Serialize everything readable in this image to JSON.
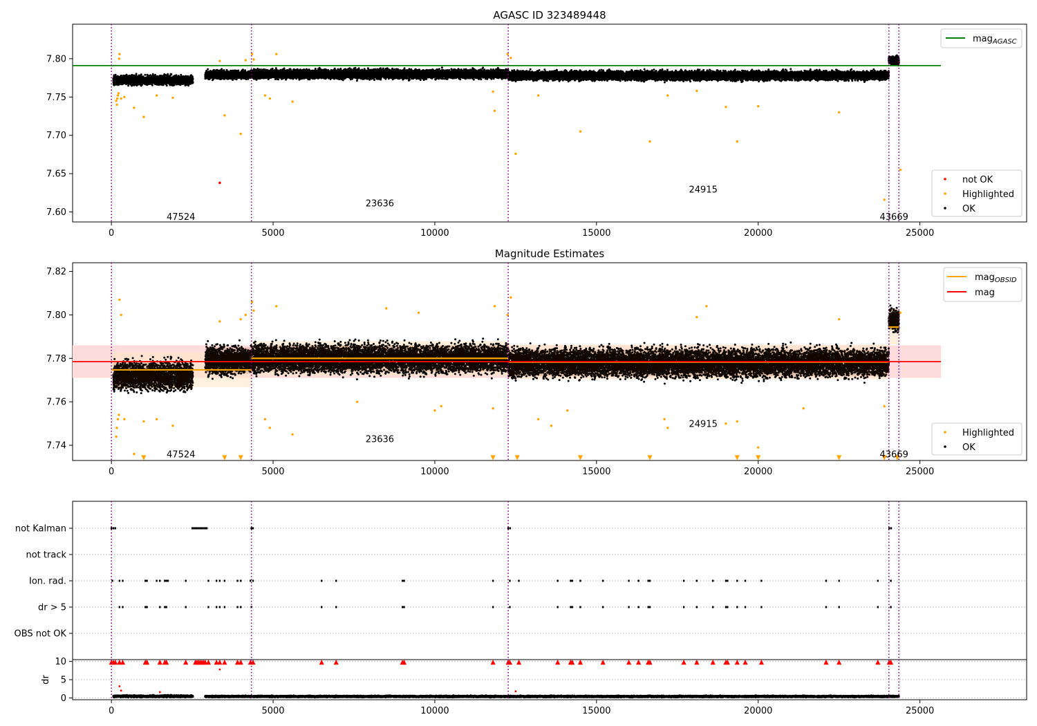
{
  "figure": {
    "panel1_title": "AGASC ID 323489448",
    "panel2_title": "Magnitude Estimates"
  },
  "colors": {
    "ok": "#000000",
    "not_ok": "#ff0000",
    "highlighted": "#ffa500",
    "mag_agasc": "#008000",
    "mag_obsid": "#ffa500",
    "mag": "#ff0000",
    "obs_boundary": "#800080",
    "mag_band": "#ffdcdc",
    "obsid_band": "#ffe8c8",
    "flag_marks": "#000000"
  },
  "chart_data": [
    {
      "type": "scatter",
      "title": "AGASC ID 323489448",
      "xlim": [
        -1200,
        28300
      ],
      "ylim": [
        7.587,
        7.845
      ],
      "x_ticks": [
        0,
        5000,
        10000,
        15000,
        20000,
        25000
      ],
      "y_ticks": [
        7.6,
        7.65,
        7.7,
        7.75,
        7.8
      ],
      "y_tick_labels": [
        "7.60",
        "7.65",
        "7.70",
        "7.75",
        "7.80"
      ],
      "grid": false,
      "observation_boundaries": [
        0,
        4330,
        12270,
        24040,
        24350
      ],
      "observation_labels": [
        {
          "text": "47524",
          "x": 2150,
          "y": 7.594
        },
        {
          "text": "23636",
          "x": 8300,
          "y": 7.612
        },
        {
          "text": "24915",
          "x": 18300,
          "y": 7.63
        },
        {
          "text": "43669",
          "x": 24200,
          "y": 7.594
        }
      ],
      "legend_lines": {
        "position": "top-right",
        "entries": [
          {
            "label": "mag",
            "sub": "AGASC",
            "color": "#008000"
          }
        ]
      },
      "legend_points": {
        "position": "bottom-right",
        "entries": [
          {
            "label": "not OK",
            "color": "#ff0000"
          },
          {
            "label": "Highlighted",
            "color": "#ffa500"
          },
          {
            "label": "OK",
            "color": "#000000"
          }
        ]
      },
      "series": [
        {
          "name": "mag",
          "sub": "AGASC",
          "kind": "line",
          "x": [
            -1200,
            25650
          ],
          "y": [
            7.791,
            7.791
          ]
        },
        {
          "name": "OK",
          "kind": "band_scatter",
          "segments": [
            {
              "x0": 60,
              "x1": 2520,
              "center": 7.772,
              "spread": 0.01
            },
            {
              "x0": 2900,
              "x1": 4330,
              "center": 7.779,
              "spread": 0.009
            },
            {
              "x0": 4330,
              "x1": 12270,
              "center": 7.78,
              "spread": 0.01
            },
            {
              "x0": 12270,
              "x1": 24040,
              "center": 7.778,
              "spread": 0.01
            },
            {
              "x0": 24040,
              "x1": 24350,
              "center": 7.798,
              "spread": 0.008
            }
          ]
        },
        {
          "name": "not OK",
          "kind": "points",
          "x": [
            3350
          ],
          "y": [
            7.638
          ]
        },
        {
          "name": "Highlighted",
          "kind": "points",
          "x": [
            150,
            170,
            180,
            200,
            220,
            240,
            250,
            300,
            400,
            700,
            1000,
            1400,
            1900,
            3350,
            3500,
            4000,
            4150,
            4350,
            4400,
            4750,
            4900,
            5100,
            5600,
            11800,
            11850,
            12250,
            12350,
            12500,
            13200,
            14500,
            16650,
            17200,
            18100,
            19000,
            19350,
            20000,
            22500,
            23900,
            24400
          ],
          "y": [
            7.745,
            7.74,
            7.748,
            7.752,
            7.755,
            7.8,
            7.806,
            7.748,
            7.75,
            7.736,
            7.724,
            7.752,
            7.749,
            7.797,
            7.726,
            7.702,
            7.798,
            7.806,
            7.799,
            7.752,
            7.748,
            7.806,
            7.744,
            7.757,
            7.732,
            7.806,
            7.801,
            7.676,
            7.752,
            7.705,
            7.692,
            7.752,
            7.758,
            7.737,
            7.692,
            7.738,
            7.73,
            7.616,
            7.655
          ]
        }
      ]
    },
    {
      "type": "scatter",
      "title": "Magnitude Estimates",
      "xlim": [
        -1200,
        28300
      ],
      "ylim": [
        7.733,
        7.824
      ],
      "x_ticks": [
        0,
        5000,
        10000,
        15000,
        20000,
        25000
      ],
      "y_ticks": [
        7.74,
        7.76,
        7.78,
        7.8,
        7.82
      ],
      "y_tick_labels": [
        "7.74",
        "7.76",
        "7.78",
        "7.80",
        "7.82"
      ],
      "grid": false,
      "observation_boundaries": [
        0,
        4330,
        12270,
        24040,
        24350
      ],
      "observation_labels": [
        {
          "text": "47524",
          "x": 2150,
          "y": 7.736
        },
        {
          "text": "23636",
          "x": 8300,
          "y": 7.743
        },
        {
          "text": "24915",
          "x": 18300,
          "y": 7.75
        },
        {
          "text": "43669",
          "x": 24200,
          "y": 7.736
        }
      ],
      "legend_lines": {
        "position": "top-right",
        "entries": [
          {
            "label": "mag",
            "sub": "OBSID",
            "color": "#ffa500"
          },
          {
            "label": "mag",
            "sub": "",
            "color": "#ff0000"
          }
        ]
      },
      "legend_points": {
        "position": "bottom-right",
        "entries": [
          {
            "label": "Highlighted",
            "color": "#ffa500"
          },
          {
            "label": "OK",
            "color": "#000000"
          }
        ]
      },
      "mag_band": {
        "x0": -1200,
        "x1": 25650,
        "y0": 7.771,
        "y1": 7.786
      },
      "series": [
        {
          "name": "mag",
          "kind": "line",
          "x": [
            -1200,
            25650
          ],
          "y": [
            7.7785,
            7.7785
          ]
        },
        {
          "name": "mag",
          "sub": "OBSID",
          "kind": "step",
          "segments": [
            {
              "x0": 0,
              "x1": 4330,
              "y": 7.7747
            },
            {
              "x0": 4330,
              "x1": 12270,
              "y": 7.78
            },
            {
              "x0": 12270,
              "x1": 24040,
              "y": 7.7783
            },
            {
              "x0": 24040,
              "x1": 24350,
              "y": 7.7944
            }
          ]
        },
        {
          "name": "OK",
          "kind": "band_scatter",
          "segments": [
            {
              "x0": 60,
              "x1": 2520,
              "center": 7.772,
              "spread": 0.011
            },
            {
              "x0": 2900,
              "x1": 4330,
              "center": 7.779,
              "spread": 0.011
            },
            {
              "x0": 4330,
              "x1": 12270,
              "center": 7.78,
              "spread": 0.011
            },
            {
              "x0": 12270,
              "x1": 24040,
              "center": 7.778,
              "spread": 0.011
            },
            {
              "x0": 24040,
              "x1": 24350,
              "center": 7.798,
              "spread": 0.009
            }
          ]
        },
        {
          "name": "Highlighted",
          "kind": "points",
          "x": [
            150,
            170,
            200,
            230,
            250,
            300,
            400,
            700,
            1000,
            1400,
            1900,
            3350,
            4000,
            4150,
            4350,
            4400,
            4750,
            4900,
            5100,
            5600,
            7600,
            8500,
            9500,
            10000,
            10200,
            11800,
            11850,
            12250,
            12350,
            13200,
            13600,
            14100,
            17100,
            17200,
            18100,
            18400,
            19000,
            19350,
            20000,
            21400,
            22500,
            23900,
            24400
          ],
          "y": [
            7.744,
            7.748,
            7.752,
            7.754,
            7.807,
            7.8,
            7.752,
            7.736,
            7.751,
            7.752,
            7.749,
            7.797,
            7.798,
            7.8,
            7.806,
            7.802,
            7.752,
            7.748,
            7.804,
            7.745,
            7.76,
            7.803,
            7.801,
            7.756,
            7.758,
            7.757,
            7.804,
            7.8,
            7.808,
            7.752,
            7.749,
            7.756,
            7.752,
            7.748,
            7.799,
            7.804,
            7.75,
            7.751,
            7.739,
            7.757,
            7.798,
            7.758,
            7.801
          ]
        },
        {
          "name": "Highlighted (below axis)",
          "kind": "triangles",
          "x": [
            1000,
            3500,
            4000,
            11800,
            12550,
            14500,
            16650,
            19350,
            20000,
            22500,
            23900,
            24300
          ]
        }
      ]
    },
    {
      "type": "scatter",
      "title": "",
      "xlim": [
        -1200,
        28300
      ],
      "categories": [
        "not Kalman",
        "not track",
        "Ion. rad.",
        "dr > 5",
        "OBS not OK"
      ],
      "grid": "horizontal dotted",
      "observation_boundaries": [
        0,
        4330,
        12270,
        24040,
        24350
      ],
      "flags": {
        "not Kalman": [
          0,
          60,
          120,
          2500,
          2550,
          2600,
          2650,
          2700,
          2750,
          2800,
          2850,
          2900,
          2950,
          4330,
          4380,
          12270,
          12330,
          24050,
          24110
        ],
        "not track": [],
        "Ion. rad.": [
          30,
          250,
          350,
          1050,
          1100,
          1400,
          1500,
          1650,
          1700,
          1750,
          2300,
          3000,
          3250,
          3350,
          3500,
          3900,
          4000,
          4300,
          4380,
          6500,
          6950,
          9000,
          9050,
          11800,
          12320,
          12600,
          13800,
          14200,
          14250,
          14500,
          15200,
          16000,
          16300,
          16600,
          16650,
          17700,
          18100,
          18600,
          19000,
          19050,
          19350,
          19600,
          20100,
          22100,
          22500,
          23700,
          24100
        ],
        "dr > 5": [
          250,
          350,
          1050,
          1100,
          1500,
          1650,
          1700,
          2300,
          3000,
          3250,
          3350,
          3500,
          3900,
          4000,
          4330,
          6500,
          6950,
          9000,
          9050,
          11800,
          12320,
          13800,
          14200,
          14250,
          14500,
          15200,
          16000,
          16300,
          16600,
          16650,
          17700,
          18100,
          18600,
          19000,
          19050,
          19350,
          19600,
          20100,
          22100,
          22500,
          23700,
          24100
        ],
        "OBS not OK": []
      }
    },
    {
      "type": "scatter",
      "ylabel": "dr",
      "xlim": [
        -1200,
        28300
      ],
      "ylim": [
        -0.5,
        10.5
      ],
      "x_ticks": [
        0,
        5000,
        10000,
        15000,
        20000,
        25000
      ],
      "y_ticks": [
        0,
        5,
        10
      ],
      "grid": "horizontal dotted",
      "observation_boundaries": [
        0,
        4330,
        12270,
        24040,
        24350
      ],
      "series": [
        {
          "name": "dr",
          "kind": "band_scatter",
          "segments": [
            {
              "x0": 60,
              "x1": 2520,
              "center": 0.45,
              "spread": 0.45
            },
            {
              "x0": 2900,
              "x1": 24350,
              "center": 0.4,
              "spread": 0.35
            }
          ]
        },
        {
          "name": "dr outliers",
          "kind": "points",
          "x": [
            250,
            300,
            1500,
            3350,
            12500
          ],
          "y": [
            3.2,
            2.0,
            1.6,
            7.8,
            1.8
          ]
        },
        {
          "name": "dr clipped",
          "kind": "triangles_up",
          "x": [
            0,
            60,
            120,
            250,
            350,
            1050,
            1100,
            1500,
            1650,
            1700,
            2300,
            2600,
            2650,
            2700,
            2750,
            2800,
            2850,
            2900,
            3000,
            3250,
            3350,
            3500,
            3900,
            4000,
            4300,
            4380,
            6500,
            6950,
            9000,
            9050,
            11800,
            12270,
            12320,
            12600,
            13800,
            14200,
            14250,
            14500,
            15200,
            16000,
            16300,
            16600,
            16650,
            17700,
            18100,
            18600,
            19000,
            19050,
            19350,
            19600,
            20100,
            22100,
            22500,
            23700,
            24050,
            24100
          ]
        }
      ]
    }
  ]
}
